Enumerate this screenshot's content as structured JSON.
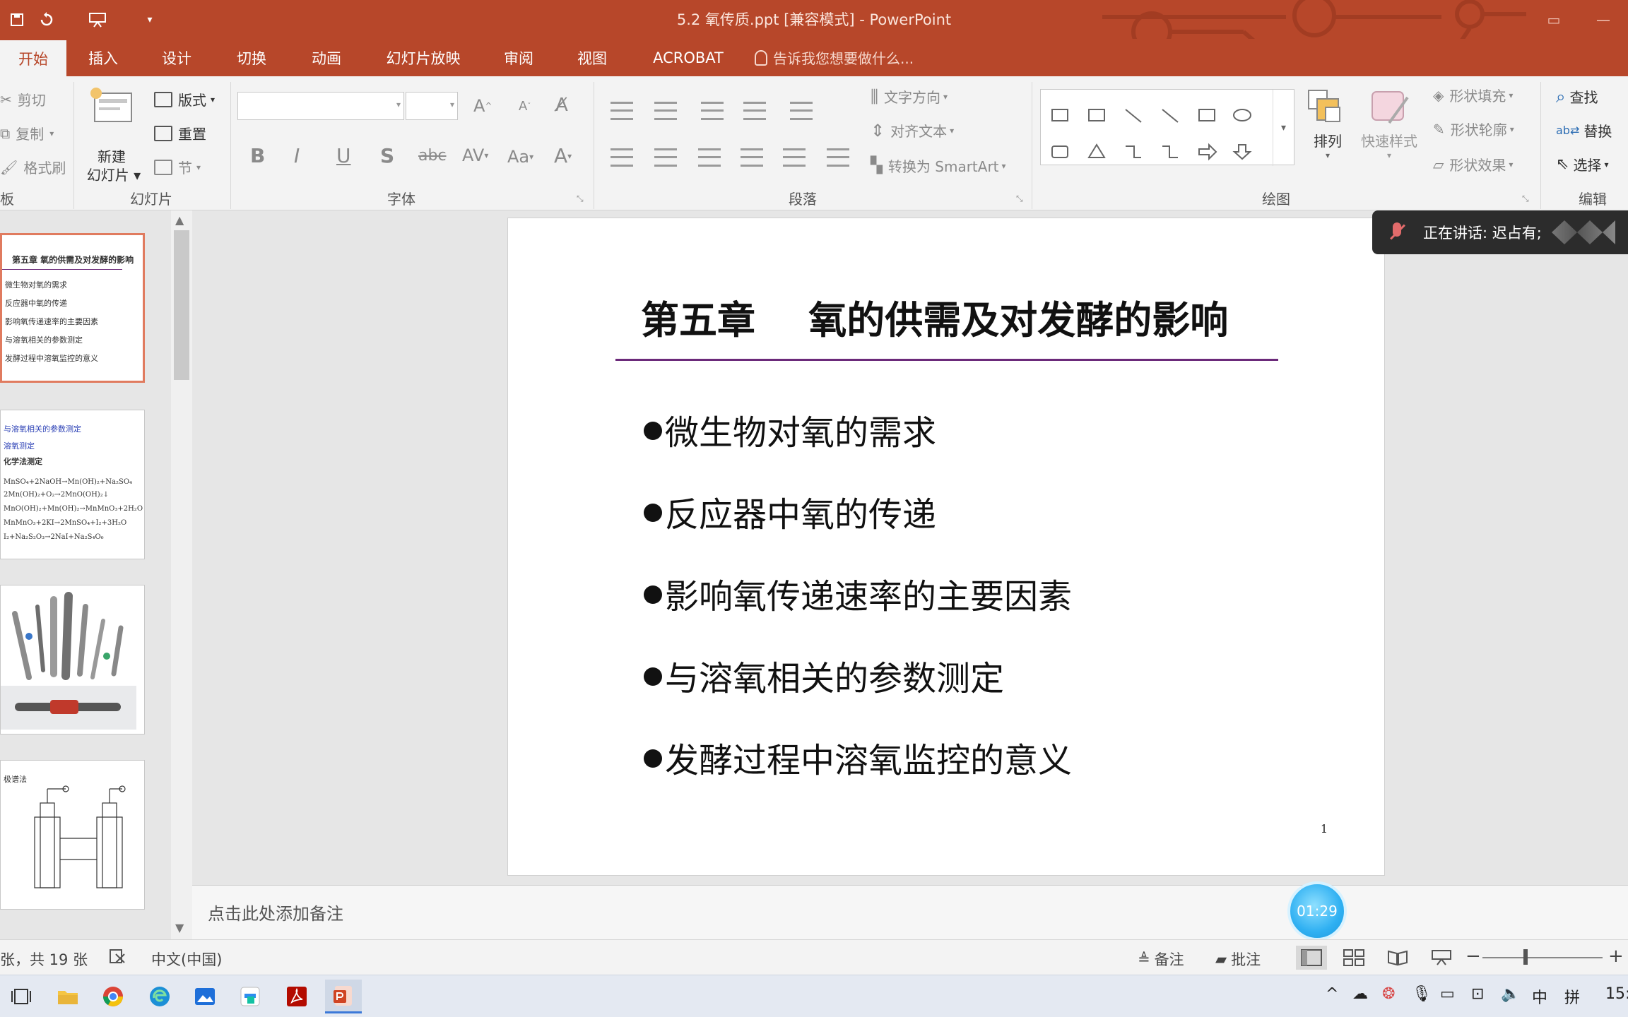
{
  "window": {
    "title": "5.2 氧传质.ppt [兼容模式] - PowerPoint"
  },
  "tabs": [
    {
      "label": "开始",
      "active": true
    },
    {
      "label": "插入"
    },
    {
      "label": "设计"
    },
    {
      "label": "切换"
    },
    {
      "label": "动画"
    },
    {
      "label": "幻灯片放映"
    },
    {
      "label": "审阅"
    },
    {
      "label": "视图"
    },
    {
      "label": "ACROBAT"
    }
  ],
  "tell_me": "告诉我您想要做什么...",
  "ribbon": {
    "clipboard": {
      "cut": "剪切",
      "copy": "复制",
      "format_painter": "格式刷",
      "group_label": "板"
    },
    "slides": {
      "new_slide_line1": "新建",
      "new_slide_line2": "幻灯片",
      "layout": "版式",
      "reset": "重置",
      "section": "节",
      "group_label": "幻灯片"
    },
    "font": {
      "group_label": "字体",
      "font_name": "",
      "font_size": ""
    },
    "paragraph": {
      "text_direction": "文字方向",
      "align_text": "对齐文本",
      "smartart": "转换为 SmartArt",
      "group_label": "段落"
    },
    "drawing": {
      "arrange": "排列",
      "quick_styles": "快速样式",
      "shape_fill": "形状填充",
      "shape_outline": "形状轮廓",
      "shape_effects": "形状效果",
      "group_label": "绘图"
    },
    "editing": {
      "find": "查找",
      "replace": "替换",
      "select": "选择",
      "group_label": "编辑"
    }
  },
  "thumbnails": [
    {
      "lines": [
        "第五章  氧的供需及对发酵的影响",
        "微生物对氧的需求",
        "反应器中氧的传递",
        "影响氧传递速率的主要因素",
        "与溶氧相关的参数测定",
        "发酵过程中溶氧监控的意义"
      ]
    },
    {
      "lines": [
        "与溶氧相关的参数测定",
        "溶氧测定",
        "化学法测定",
        "MnSO₄+2NaOH→Mn(OH)₂+Na₂SO₄",
        "2Mn(OH)₂+O₂→2MnO(OH)₂↓",
        "MnO(OH)₂+Mn(OH)₂→MnMnO₃+2H₂O",
        "MnMnO₃+2KI→2MnSO₄+I₂+3H₂O",
        "I₂+Na₂S₂O₃→2NaI+Na₂S₄O₆"
      ]
    },
    {
      "lines": []
    },
    {
      "lines": [
        "极谱法"
      ]
    }
  ],
  "slide": {
    "title": "第五章    氧的供需及对发酵的影响",
    "bullets": [
      "微生物对氧的需求",
      "反应器中氧的传递",
      "影响氧传递速率的主要因素",
      "与溶氧相关的参数测定",
      "发酵过程中溶氧监控的意义"
    ],
    "page_number": "1"
  },
  "notes_placeholder": "点击此处添加备注",
  "speaking": "正在讲话: 迟占有;",
  "timer": "01:29",
  "status": {
    "slide_info": "张，共 19 张",
    "language": "中文(中国)",
    "notes": "备注",
    "comments": "批注"
  },
  "tray": {
    "ime_lang": "中",
    "ime_mode": "拼",
    "clock": "15:"
  },
  "colors": {
    "accent": "#b7472a",
    "title_rule": "#6b2a7a"
  }
}
